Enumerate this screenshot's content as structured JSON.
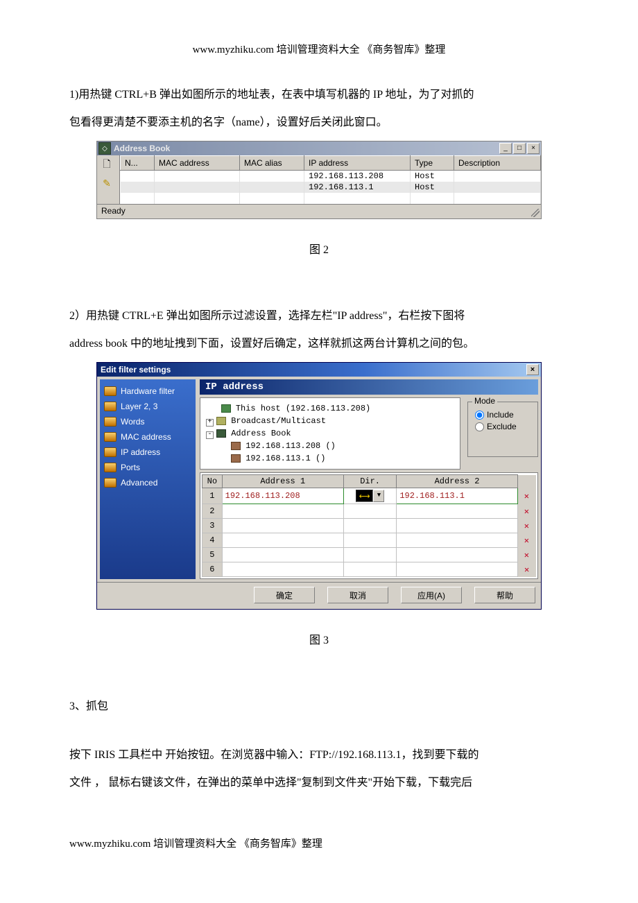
{
  "header": "www.myzhiku.com 培训管理资料大全  《商务智库》整理",
  "footer": "www.myzhiku.com 培训管理资料大全  《商务智库》整理",
  "para1a": "1)用热键 CTRL+B 弹出如图所示的地址表，在表中填写机器的 IP 地址，为了对抓的",
  "para1b": "包看得更清楚不要添主机的名字（name），设置好后关闭此窗口。",
  "caption_fig2": "图 2",
  "para2a": "2）用热键 CTRL+E 弹出如图所示过滤设置，选择左栏\"IP address\"，右栏按下图将",
  "para2b": "address book 中的地址拽到下面，设置好后确定，这样就抓这两台计算机之间的包。",
  "caption_fig3": "图 3",
  "para3": "3、抓包",
  "para4a": "按下 IRIS 工具栏中 开始按钮。在浏览器中输入：FTP://192.168.113.1，找到要下载的",
  "para4b": "文件 ， 鼠标右键该文件，在弹出的菜单中选择\"复制到文件夹\"开始下载，下载完后",
  "addressBook": {
    "title": "Address Book",
    "columns": [
      "N...",
      "MAC address",
      "MAC alias",
      "IP address",
      "Type",
      "Description"
    ],
    "rows": [
      {
        "ip": "192.168.113.208",
        "type": "Host"
      },
      {
        "ip": "192.168.113.1",
        "type": "Host"
      }
    ],
    "status": "Ready",
    "min": "_",
    "max": "□",
    "close": "×"
  },
  "filter": {
    "title": "Edit filter settings",
    "close": "×",
    "sidebar": [
      "Hardware filter",
      "Layer 2, 3",
      "Words",
      "MAC address",
      "IP address",
      "Ports",
      "Advanced"
    ],
    "panelTitle": "IP address",
    "tree": {
      "host": "This host (192.168.113.208)",
      "bcast": "Broadcast/Multicast",
      "book": "Address Book",
      "addr1": "192.168.113.208 ()",
      "addr2": "192.168.113.1 ()"
    },
    "mode": {
      "legend": "Mode",
      "include": "Include",
      "exclude": "Exclude",
      "selected": "include"
    },
    "grid": {
      "headers": [
        "No",
        "Address 1",
        "Dir.",
        "Address 2"
      ],
      "row1": {
        "no": "1",
        "a1": "192.168.113.208",
        "dir": "⟷",
        "a2": "192.168.113.1"
      },
      "empties": [
        "2",
        "3",
        "4",
        "5",
        "6"
      ],
      "del": "✕"
    },
    "buttons": {
      "ok": "确定",
      "cancel": "取消",
      "apply": "应用(A)",
      "help": "帮助"
    }
  }
}
